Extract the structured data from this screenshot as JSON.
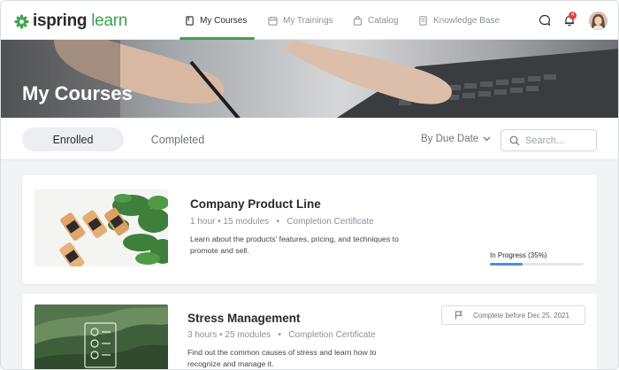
{
  "brand": {
    "word1": "ispring",
    "word2": "learn",
    "accent": "#3aa34a"
  },
  "nav": {
    "items": [
      {
        "label": "My Courses",
        "icon": "book-icon",
        "active": true
      },
      {
        "label": "My Trainings",
        "icon": "calendar-icon",
        "active": false
      },
      {
        "label": "Catalog",
        "icon": "bag-icon",
        "active": false
      },
      {
        "label": "Knowledge Base",
        "icon": "document-icon",
        "active": false
      }
    ],
    "notification_count": "4"
  },
  "hero": {
    "title": "My Courses"
  },
  "toolbar": {
    "tabs": [
      {
        "label": "Enrolled",
        "active": true
      },
      {
        "label": "Completed",
        "active": false
      }
    ],
    "sort_label": "By Due Date",
    "search_placeholder": "Search..."
  },
  "courses": [
    {
      "title": "Company Product Line",
      "duration": "1 hour",
      "modules": "15 modules",
      "certificate": "Completion Certificate",
      "description": "Learn about the products' features, pricing, and techniques to promote and sell.",
      "status_text": "In Progress (35%)",
      "progress": 0.35,
      "progress_color": "#4a8ee0"
    },
    {
      "title": "Stress Management",
      "duration": "3 hours",
      "modules": "25 modules",
      "certificate": "Completion Certificate",
      "description": "Find out the common causes of stress and learn how to recognize and manage it.",
      "due_text": "Complete before Dec 25, 2021"
    }
  ]
}
